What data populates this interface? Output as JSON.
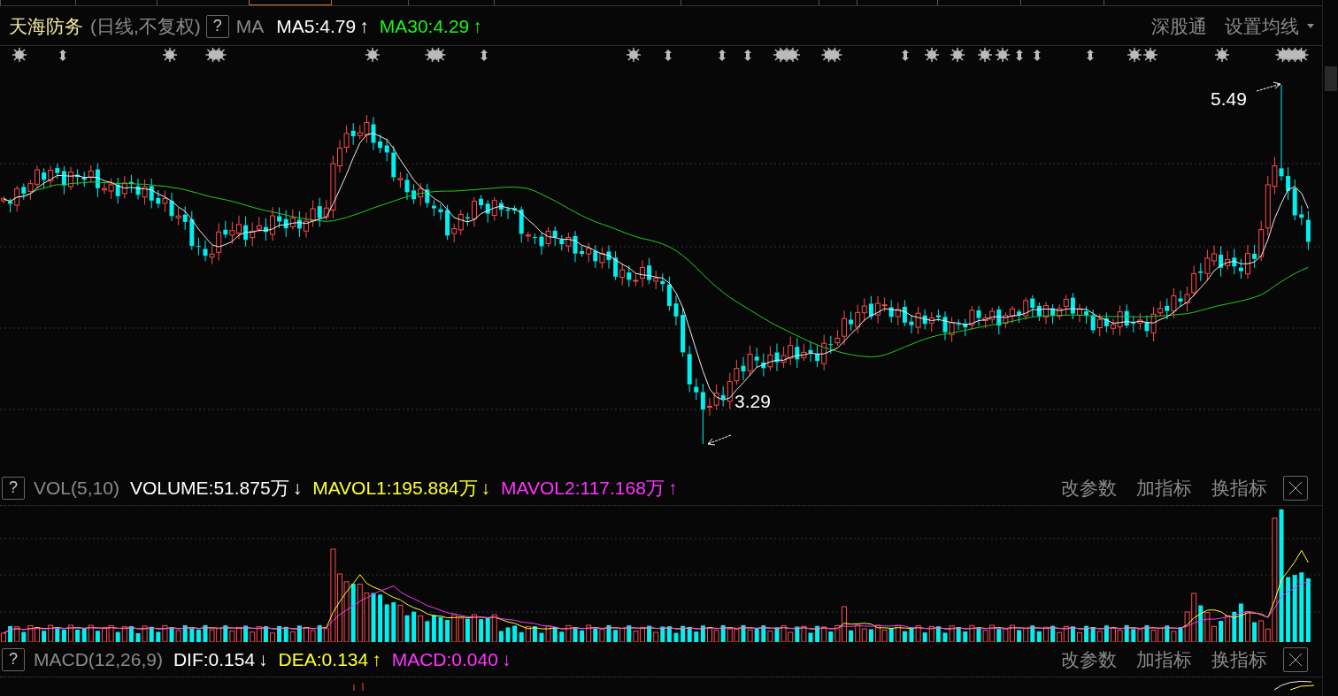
{
  "stock": {
    "name": "天海防务",
    "period": "(日线,不复权)",
    "help": "?"
  },
  "main_indicator": {
    "name": "MA",
    "values": [
      {
        "label": "MA5:4.79",
        "color": "#ffffff",
        "arrow": "↑"
      },
      {
        "label": "MA30:4.29",
        "color": "#22ee22",
        "arrow": "↑"
      }
    ]
  },
  "toolbar": {
    "connect": "深股通",
    "ma_setting": "设置均线"
  },
  "price_chart": {
    "high_label": "5.49",
    "low_label": "3.29"
  },
  "panels": [
    {
      "help": "?",
      "name": "VOL(5,10)",
      "values": [
        {
          "label": "VOLUME:51.875万",
          "color": "#ffffff",
          "arrow": "↓"
        },
        {
          "label": "MAVOL1:195.884万",
          "color": "#ffff33",
          "arrow": "↓"
        },
        {
          "label": "MAVOL2:117.168万",
          "color": "#ff33ff",
          "arrow": "↑"
        }
      ],
      "actions": [
        "改参数",
        "加指标",
        "换指标"
      ]
    },
    {
      "help": "?",
      "name": "MACD(12,26,9)",
      "values": [
        {
          "label": "DIF:0.154",
          "color": "#ffffff",
          "arrow": "↓"
        },
        {
          "label": "DEA:0.134",
          "color": "#ffff33",
          "arrow": "↑"
        },
        {
          "label": "MACD:0.040",
          "color": "#ff33ff",
          "arrow": "↓"
        }
      ],
      "actions": [
        "改参数",
        "加指标",
        "换指标"
      ]
    }
  ]
}
